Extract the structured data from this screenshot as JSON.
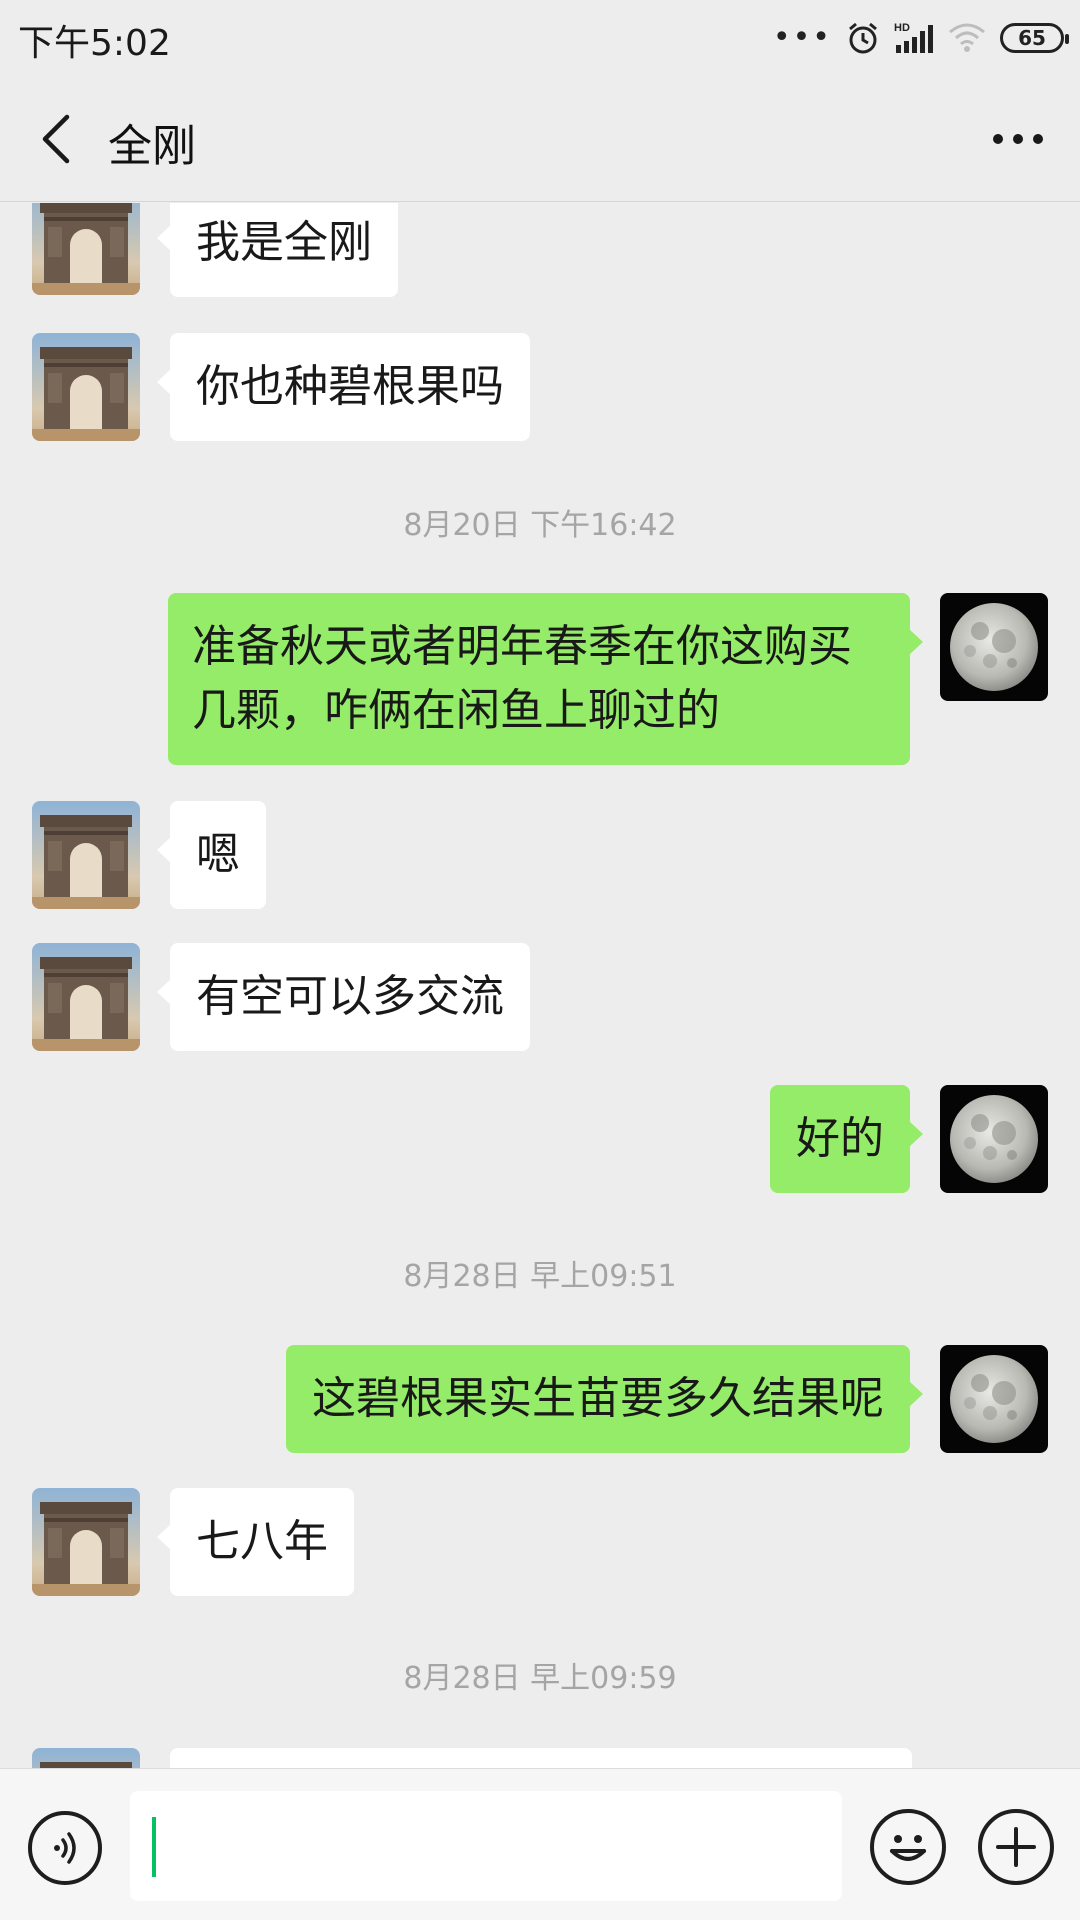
{
  "status_bar": {
    "time": "下午5:02",
    "battery": "65",
    "icons": [
      "more-dots-icon",
      "alarm-icon",
      "hd-signal-icon",
      "wifi-icon",
      "battery-icon"
    ]
  },
  "header": {
    "title": "全刚",
    "back_icon": "chevron-left-icon",
    "more_icon": "more-horizontal-icon"
  },
  "messages": [
    {
      "type": "text",
      "side": "in",
      "text": "我是全刚"
    },
    {
      "type": "text",
      "side": "in",
      "text": "你也种碧根果吗"
    },
    {
      "type": "time",
      "text": "8月20日 下午16:42"
    },
    {
      "type": "text",
      "side": "out",
      "text": "准备秋天或者明年春季在你这购买几颗，咋俩在闲鱼上聊过的"
    },
    {
      "type": "text",
      "side": "in",
      "text": "嗯"
    },
    {
      "type": "text",
      "side": "in",
      "text": "有空可以多交流"
    },
    {
      "type": "text",
      "side": "out",
      "text": "好的"
    },
    {
      "type": "time",
      "text": "8月28日 早上09:51"
    },
    {
      "type": "text",
      "side": "out",
      "text": "这碧根果实生苗要多久结果呢"
    },
    {
      "type": "text",
      "side": "in",
      "text": "七八年"
    },
    {
      "type": "time",
      "text": "8月28日 早上09:59"
    }
  ],
  "avatars": {
    "contact": "arc-de-triomphe-avatar",
    "self": "full-moon-avatar"
  },
  "input_bar": {
    "value": "",
    "icons": [
      "voice-icon",
      "emoji-icon",
      "plus-icon"
    ]
  },
  "colors": {
    "background": "#ededed",
    "incoming_bubble": "#ffffff",
    "outgoing_bubble": "#95ec69",
    "timestamp": "#a5a5a5",
    "caret": "#07c160"
  }
}
